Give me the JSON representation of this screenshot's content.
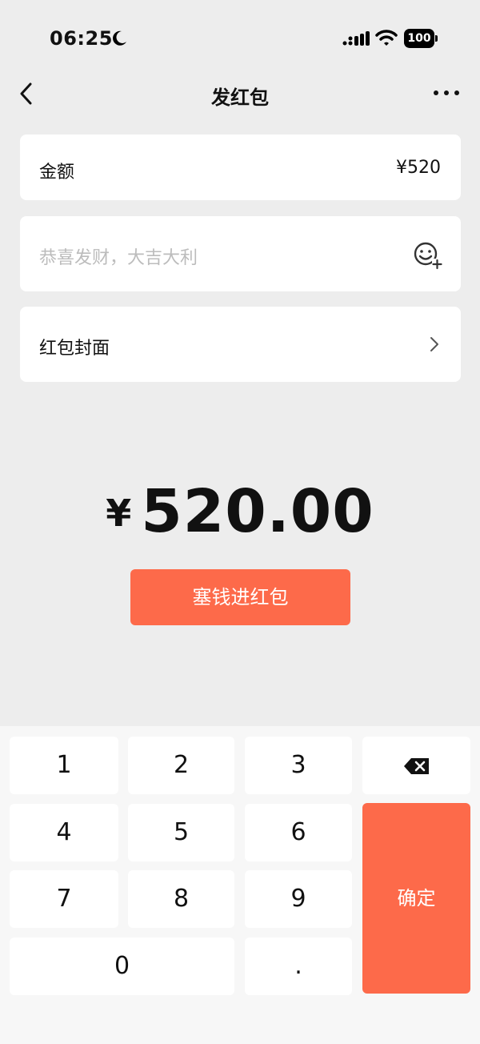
{
  "status_bar": {
    "time": "06:25",
    "battery": "100"
  },
  "nav": {
    "title": "发红包"
  },
  "amount_card": {
    "label": "金额",
    "value": "¥520"
  },
  "greeting_card": {
    "placeholder": "恭喜发财，大吉大利"
  },
  "cover_card": {
    "label": "红包封面"
  },
  "total": {
    "currency": "¥",
    "value": "520.00"
  },
  "submit_button": {
    "label": "塞钱进红包"
  },
  "keypad": {
    "keys": [
      "1",
      "2",
      "3",
      "4",
      "5",
      "6",
      "7",
      "8",
      "9",
      "0",
      "."
    ],
    "confirm_label": "确定"
  },
  "colors": {
    "accent": "#fd6a4a",
    "background": "#ededed",
    "card": "#ffffff",
    "keypad_background": "#f7f7f7",
    "placeholder": "#bcbcbc"
  },
  "icons": {
    "back": "chevron-left-icon",
    "more": "more-dots-icon",
    "emoji": "emoji-add-icon",
    "cover_arrow": "chevron-right-icon",
    "delete": "backspace-icon",
    "moon": "moon-icon",
    "signal": "cellular-signal-icon",
    "wifi": "wifi-icon",
    "battery": "battery-icon"
  }
}
